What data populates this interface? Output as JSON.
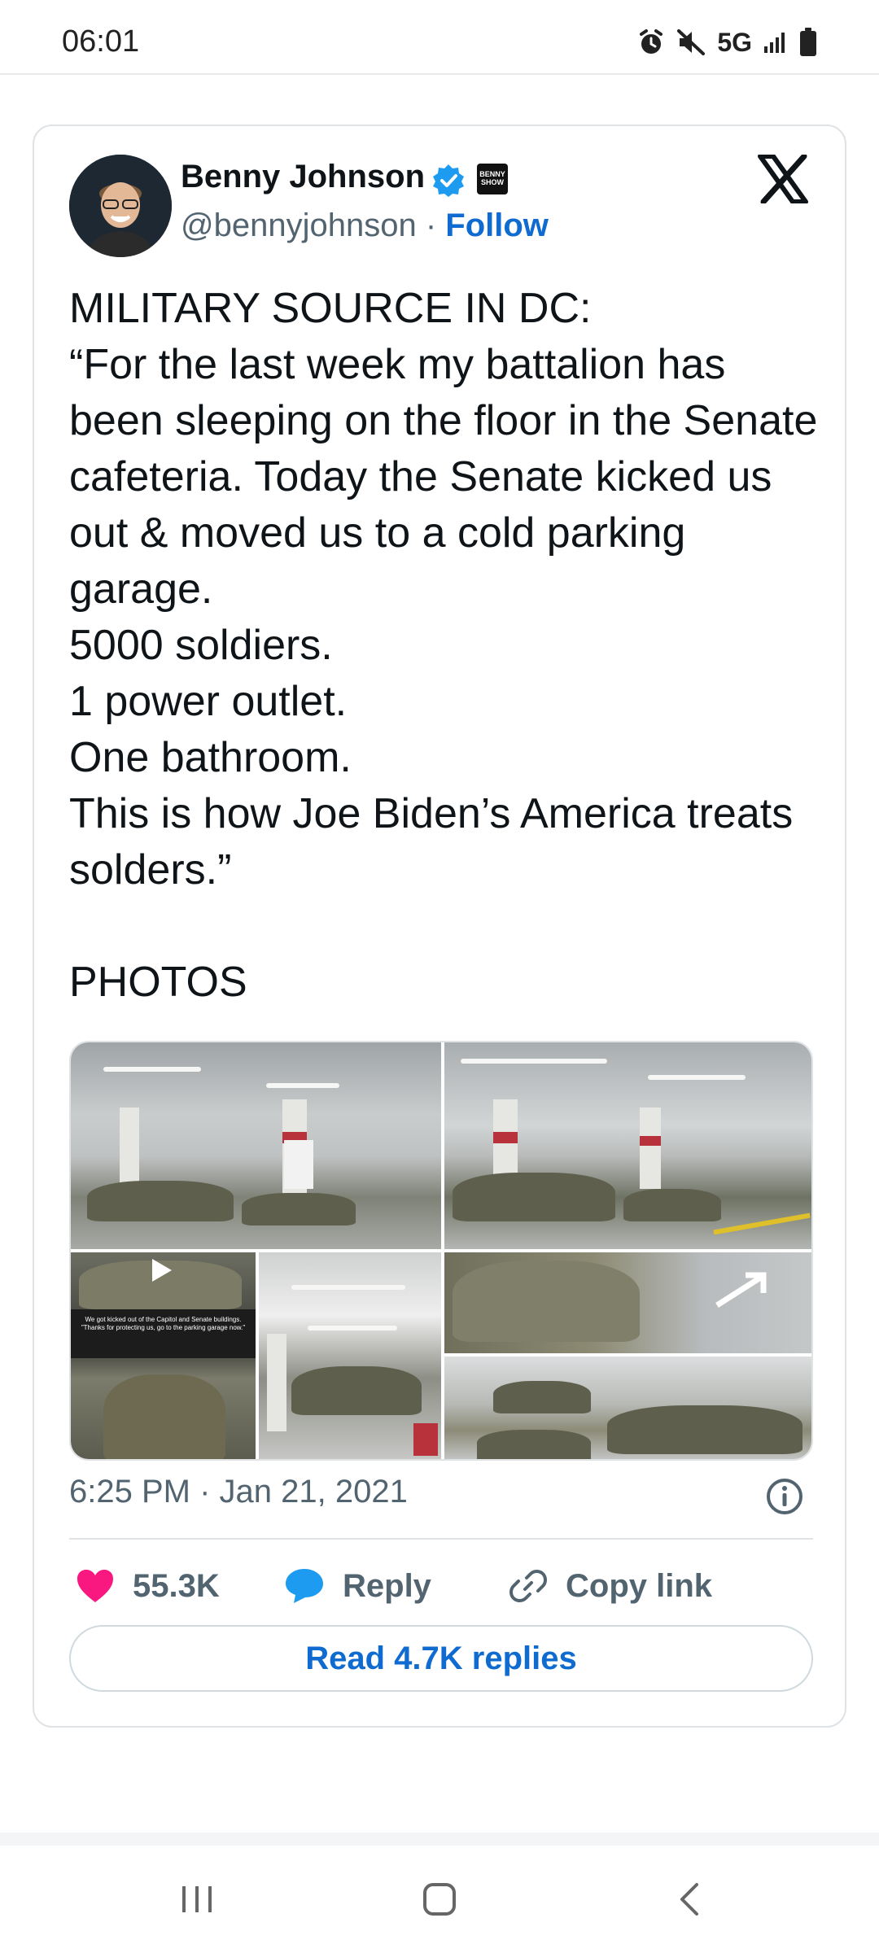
{
  "status_bar": {
    "time": "06:01",
    "network": "5G"
  },
  "tweet": {
    "author_name": "Benny Johnson",
    "handle": "@bennyjohnson",
    "separator": " · ",
    "follow_label": "Follow",
    "badge_text": "BENNY SHOW",
    "text": "MILITARY SOURCE IN DC:\n“For the last week my battalion has been sleeping on the floor in the Senate cafeteria. Today the Senate kicked us out & moved us to a cold parking garage.\n5000 soldiers.\n1 power outlet.\nOne bathroom.\nThis is how Joe Biden’s America treats solders.”\n\nPHOTOS",
    "photo_caption": "We got kicked out of the Capitol and Senate buildings. \"Thanks for protecting us, go to the parking garage now.\"",
    "timestamp": "6:25 PM · Jan 21, 2021",
    "likes": "55.3K",
    "reply_label": "Reply",
    "copy_link_label": "Copy link",
    "read_replies_label": "Read 4.7K replies"
  },
  "colors": {
    "accent_blue": "#0f6bd0",
    "like_pink": "#f91880",
    "reply_blue": "#1d9bf0",
    "muted_text": "#536471"
  },
  "icons": {
    "alarm": "alarm-icon",
    "mute": "mute-icon",
    "signal": "signal-icon",
    "battery": "battery-icon",
    "verified": "verified-badge-icon",
    "x_logo": "x-logo-icon",
    "info": "info-icon",
    "heart": "heart-icon",
    "reply": "reply-bubble-icon",
    "link": "link-icon",
    "recents": "recents-icon",
    "home": "home-icon",
    "back": "back-icon"
  }
}
